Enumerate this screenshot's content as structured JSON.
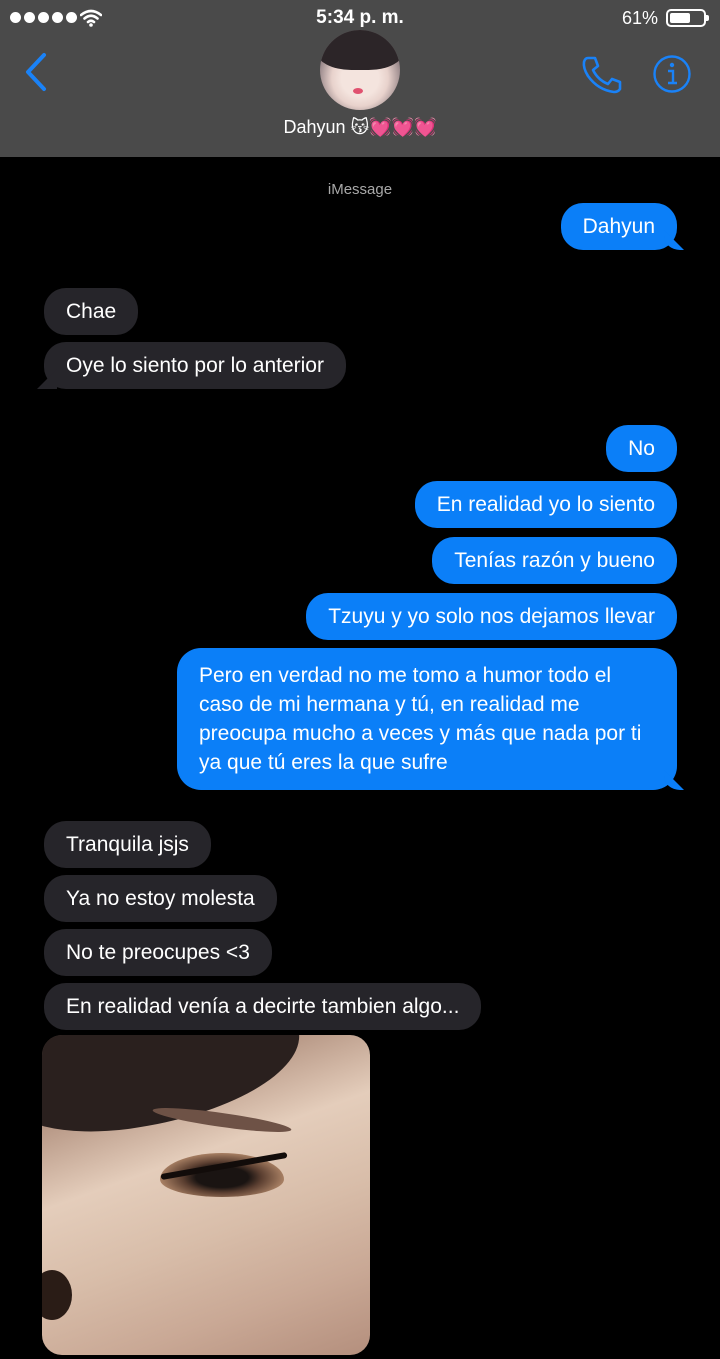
{
  "status_bar": {
    "time": "5:34 p. m.",
    "battery": "61%",
    "battery_level": 0.61
  },
  "header": {
    "contact_name": "Dahyun 😽💓💓💓"
  },
  "thread": {
    "service_label": "iMessage",
    "messages": [
      {
        "direction": "outgoing",
        "text": "Dahyun"
      },
      {
        "direction": "incoming",
        "text": "Chae"
      },
      {
        "direction": "incoming",
        "text": "Oye lo siento por lo anterior"
      },
      {
        "direction": "outgoing",
        "text": "No"
      },
      {
        "direction": "outgoing",
        "text": "En realidad yo lo siento"
      },
      {
        "direction": "outgoing",
        "text": "Tenías razón y bueno"
      },
      {
        "direction": "outgoing",
        "text": "Tzuyu y yo solo nos dejamos llevar"
      },
      {
        "direction": "outgoing",
        "text": "Pero en verdad no me tomo a humor todo el caso de mi hermana y tú, en realidad me preocupa mucho a veces y más que nada por ti ya que tú eres la que sufre"
      },
      {
        "direction": "incoming",
        "text": "Tranquila jsjs"
      },
      {
        "direction": "incoming",
        "text": "Ya no estoy molesta"
      },
      {
        "direction": "incoming",
        "text": "No te preocupes <3"
      },
      {
        "direction": "incoming",
        "text": "En realidad venía a decirte tambien algo..."
      }
    ]
  },
  "colors": {
    "header_bg": "#4a4a4a",
    "outgoing_bubble": "#0b7ff8",
    "incoming_bubble": "#26252a",
    "accent": "#1a82f7"
  },
  "icons": [
    "back-chevron-icon",
    "phone-icon",
    "info-icon",
    "wifi-icon"
  ]
}
